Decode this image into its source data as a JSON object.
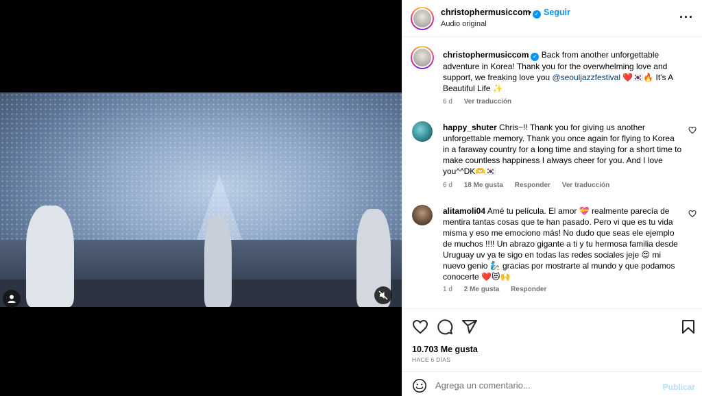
{
  "header": {
    "username": "christophermusiccom",
    "separator": "•",
    "follow_label": "Seguir",
    "subtitle": "Audio original",
    "more_icon": "more-horizontal-icon"
  },
  "caption": {
    "username": "christophermusiccom",
    "text": "Back from another unforgettable adventure in Korea! Thank you for the overwhelming love and support, we freaking love you",
    "mention": "@seouljazzfestival",
    "suffix": "❤️🇰🇷🔥 It's A Beautiful Life ✨",
    "time": "6 d",
    "translate_label": "Ver traducción"
  },
  "comments": [
    {
      "username": "happy_shuter",
      "text": "Chris~!! Thank you for giving us another unforgettable memory. Thank you once again for flying to Korea in a faraway country for a long time and staying for a short time to make countless happiness I always cheer for you. And I love you^^DK🫶🇰🇷",
      "time": "6 d",
      "likes": "18 Me gusta",
      "reply_label": "Responder",
      "translate_label": "Ver traducción"
    },
    {
      "username": "alitamoli04",
      "text": "Amé tu película. El amor 💝 realmente parecía de mentira tantas cosas que te han pasado. Pero vi que es tu vida misma y eso me emociono más! No dudo que seas ele ejemplo de muchos !!!! Un abrazo gigante a ti y tu hermosa familia desde Uruguay uv ya te sigo en todas las redes sociales jeje 😍 mi nuevo genio 🧞 gracias por mostrarte al mundo y que podamos conocerte ❤️😻🙌",
      "time": "1 d",
      "likes": "2 Me gusta",
      "reply_label": "Responder"
    }
  ],
  "actions": {
    "like_icon": "heart-icon",
    "comment_icon": "comment-icon",
    "share_icon": "send-icon",
    "save_icon": "bookmark-icon",
    "likes_count": "10.703 Me gusta",
    "posted_ago": "HACE 6 DÍAS"
  },
  "composer": {
    "placeholder": "Agrega un comentario...",
    "publish_label": "Publicar",
    "emoji_icon": "emoji-icon"
  },
  "colors": {
    "accent": "#0095f6",
    "muted": "#737373",
    "publish_disabled": "#b2dffc",
    "mention": "#00376b"
  }
}
